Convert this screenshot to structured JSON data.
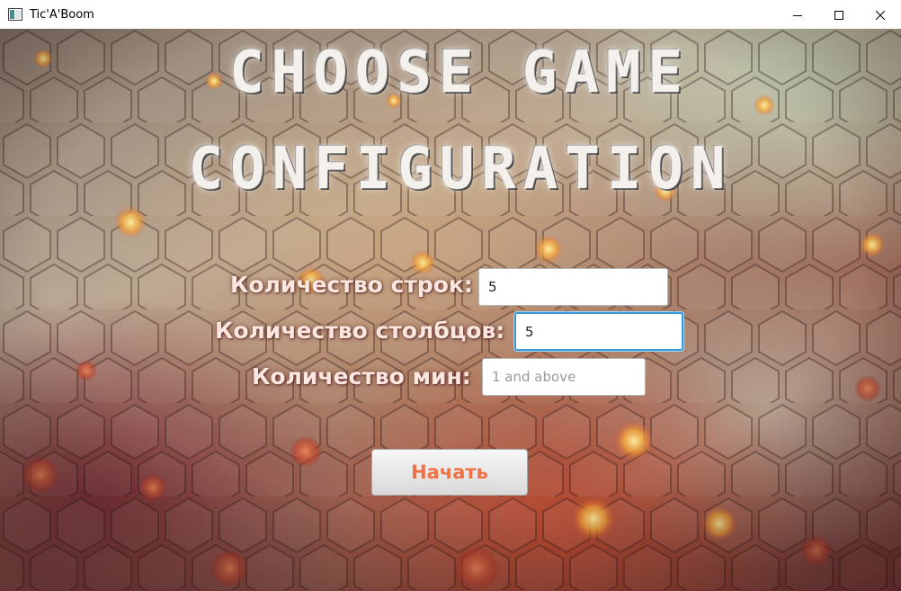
{
  "window": {
    "title": "Tic'A'Boom",
    "icon": "app-window-icon",
    "controls": [
      "minimize-icon",
      "maximize-icon",
      "close-icon"
    ]
  },
  "heading": {
    "line1": "CHOOSE GAME",
    "line2": "CONFIGURATION"
  },
  "form": {
    "rows_label": "Количество строк:",
    "rows_value": "5",
    "columns_label": "Количество столбцов:",
    "columns_value": "5",
    "mines_label": "Количество мин:",
    "mines_value": "",
    "mines_placeholder": "1 and above"
  },
  "actions": {
    "start_label": "Начать"
  },
  "colors": {
    "label_text": "#fbe7df",
    "button_text": "#f07048",
    "focus_border": "#3a99d8"
  }
}
